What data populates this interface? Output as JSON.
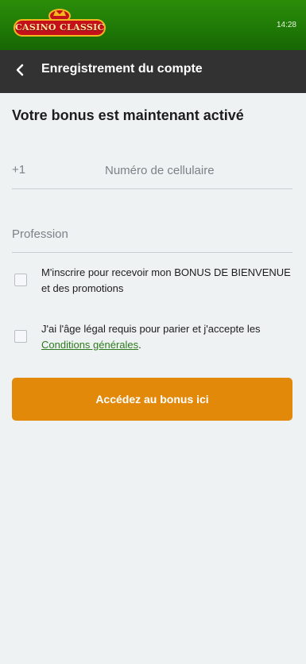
{
  "status_bar": {
    "time": "14:28"
  },
  "brand": {
    "logo_text": "CASINO CLASSIC"
  },
  "header": {
    "title": "Enregistrement du compte"
  },
  "page": {
    "title": "Votre bonus est maintenant activé"
  },
  "form": {
    "phone": {
      "prefix": "+1",
      "placeholder": "Numéro de cellulaire",
      "value": ""
    },
    "profession": {
      "placeholder": "Profession",
      "value": ""
    },
    "checkboxes": [
      {
        "label": "M'inscrire pour recevoir mon BONUS DE BIENVENUE et des promotions",
        "checked": false
      },
      {
        "label_before": "J'ai l'âge légal requis pour parier et j'accepte les ",
        "link_text": "Conditions générales",
        "label_after": ".",
        "checked": false
      }
    ],
    "submit_label": "Accédez au bonus ici"
  },
  "colors": {
    "topbar": "#1f7a06",
    "header": "#323232",
    "background": "#eff2f3",
    "cta": "#e2890a",
    "link": "#2d7a1c"
  }
}
